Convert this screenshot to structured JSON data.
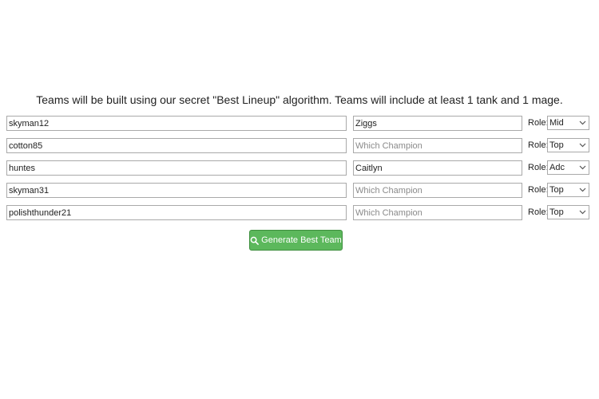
{
  "intro": {
    "text": "Teams will be built using our secret \"Best Lineup\" algorithm. Teams will include at least 1 tank and 1 mage."
  },
  "role_label": "Role:",
  "rows": [
    {
      "summoner": "skyman12",
      "champion": "Ziggs",
      "champion_placeholder": "Which Champion",
      "role": "Mid"
    },
    {
      "summoner": "cotton85",
      "champion": "",
      "champion_placeholder": "Which Champion",
      "role": "Top"
    },
    {
      "summoner": "huntes",
      "champion": "Caitlyn",
      "champion_placeholder": "Which Champion",
      "role": "Adc"
    },
    {
      "summoner": "skyman31",
      "champion": "",
      "champion_placeholder": "Which Champion",
      "role": "Top"
    },
    {
      "summoner": "polishthunder21",
      "champion": "",
      "champion_placeholder": "Which Champion",
      "role": "Top"
    }
  ],
  "generate_button": {
    "label": "Generate Best Team",
    "icon": "search-icon",
    "color": "#5cb85c"
  }
}
